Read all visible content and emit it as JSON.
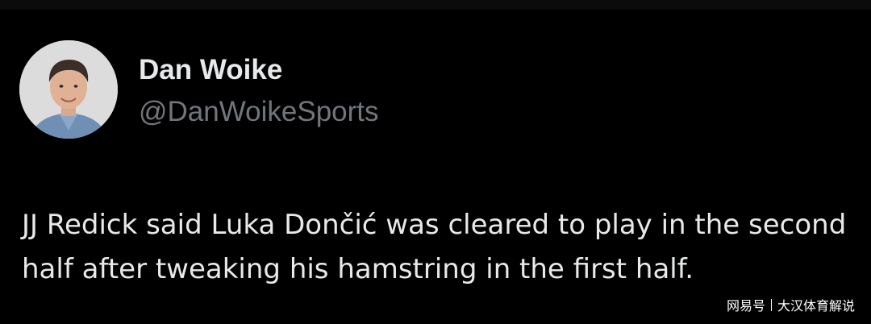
{
  "tweet": {
    "author": {
      "display_name": "Dan Woike",
      "handle": "@DanWoikeSports"
    },
    "text": "JJ Redick said Luka Dončić was cleared to play in the second half after tweaking his hamstring in the first half."
  },
  "watermark": {
    "brand": "网易号",
    "account": "大汉体育解说"
  },
  "colors": {
    "background": "#000000",
    "primary_text": "#e7e9ea",
    "secondary_text": "#71767b"
  }
}
